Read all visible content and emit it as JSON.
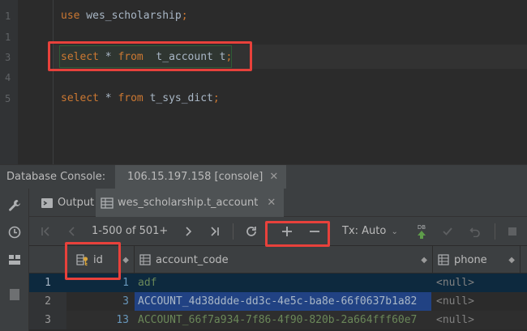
{
  "editor": {
    "line_numbers": [
      "1",
      "1",
      "3",
      "4",
      "5"
    ],
    "lines": [
      {
        "kw": "use",
        "rest": " wes_scholarship",
        "semi": ";"
      },
      {
        "kw": "select",
        "op": " * ",
        "kw2": "from",
        "rest": "  t_account t",
        "semi": ";"
      },
      {
        "kw": "select",
        "op": " * ",
        "kw2": "from",
        "rest": " t_sys_dict",
        "semi": ";"
      }
    ]
  },
  "console": {
    "label": "Database Console:",
    "tab_title": "106.15.197.158 [console]",
    "close_glyph": "✕"
  },
  "results": {
    "tabs": [
      {
        "label": "Output"
      },
      {
        "label": "wes_scholarship.t_account"
      }
    ],
    "close_glyph": "✕"
  },
  "toolbar": {
    "page_range": "1-500 of 501+",
    "tx_mode": "Tx: Auto",
    "db_badge": "DB"
  },
  "grid": {
    "columns": [
      {
        "label": "id"
      },
      {
        "label": "account_code"
      },
      {
        "label": "phone"
      }
    ],
    "rows": [
      {
        "num": "1",
        "id": "1",
        "code": "adf",
        "phone": "<null>"
      },
      {
        "num": "2",
        "id": "3",
        "code": "ACCOUNT_4d38ddde-dd3c-4e5c-ba8e-66f0637b1a82",
        "phone": "<null>"
      },
      {
        "num": "3",
        "id": "13",
        "code": "ACCOUNT_66f7a934-7f86-4f90-820b-2a664fff60e7",
        "phone": "<null>"
      }
    ]
  },
  "colors": {
    "keyword": "#cc7832",
    "highlight_box": "#e8413b",
    "selection": "#214283"
  }
}
